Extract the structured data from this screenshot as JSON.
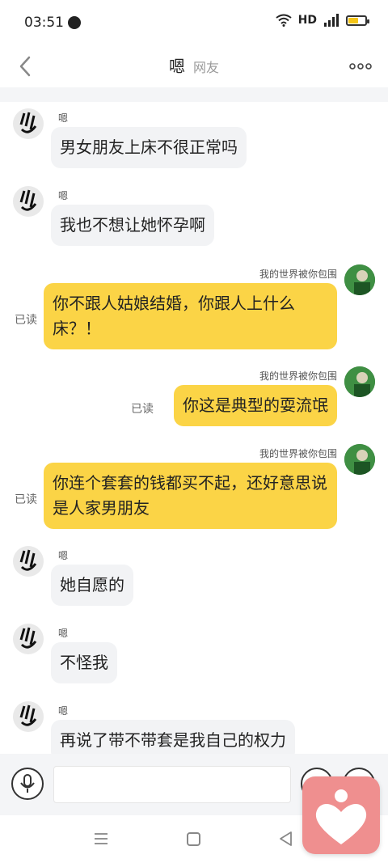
{
  "status_bar": {
    "time": "03:51",
    "hd": "HD",
    "network": "4G",
    "battery_level": 0.6,
    "battery_color": "#f5c518"
  },
  "header": {
    "title": "嗯",
    "subtitle": "网友",
    "back_icon": "chevron-left-icon",
    "more_icon": "more-dots-icon"
  },
  "messages": [
    {
      "side": "left",
      "sender": "嗯",
      "text": "男女朋友上床不很正常吗"
    },
    {
      "side": "left",
      "sender": "嗯",
      "text": "我也不想让她怀孕啊"
    },
    {
      "side": "right",
      "sender": "我的世界被你包围",
      "text": "你不跟人姑娘结婚，你跟人上什么床？！",
      "read": "已读"
    },
    {
      "side": "right",
      "sender": "我的世界被你包围",
      "text": "你这是典型的耍流氓",
      "read": "已读"
    },
    {
      "side": "right",
      "sender": "我的世界被你包围",
      "text": "你连个套套的钱都买不起，还好意思说是人家男朋友",
      "read": "已读"
    },
    {
      "side": "left",
      "sender": "嗯",
      "text": "她自愿的"
    },
    {
      "side": "left",
      "sender": "嗯",
      "text": "不怪我"
    },
    {
      "side": "left",
      "sender": "嗯",
      "text": "再说了带不带套是我自己的权力"
    }
  ],
  "input_bar": {
    "value": "",
    "mic_icon": "microphone-icon",
    "emoji_icon": "emoji-icon",
    "plus_icon": "plus-icon"
  },
  "colors": {
    "my_bubble": "#fbd446",
    "their_bubble": "#f2f3f5",
    "logo_bg": "#ef8f8f"
  }
}
